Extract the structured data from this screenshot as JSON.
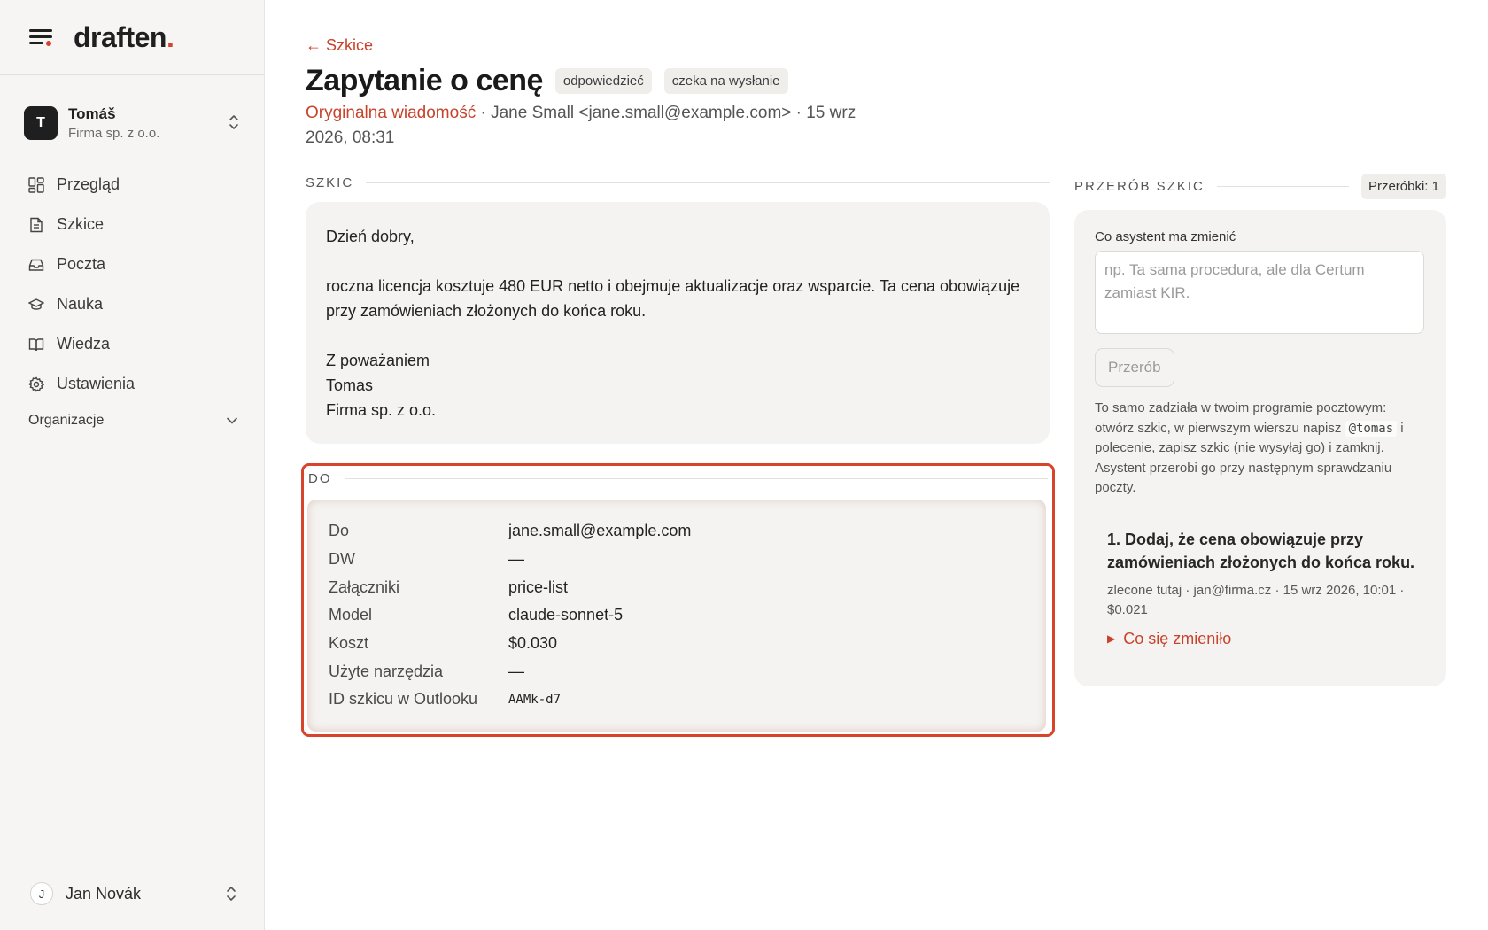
{
  "brand": {
    "name": "draften",
    "dot": "."
  },
  "org": {
    "initial": "T",
    "name": "Tomáš",
    "subtitle": "Firma sp. z o.o."
  },
  "nav": [
    {
      "label": "Przegląd",
      "icon": "grid-icon"
    },
    {
      "label": "Szkice",
      "icon": "file-icon"
    },
    {
      "label": "Poczta",
      "icon": "inbox-icon"
    },
    {
      "label": "Nauka",
      "icon": "graduation-cap-icon"
    },
    {
      "label": "Wiedza",
      "icon": "book-icon"
    },
    {
      "label": "Ustawienia",
      "icon": "gear-icon"
    }
  ],
  "organizations_label": "Organizacje",
  "user": {
    "initial": "J",
    "name": "Jan Novák"
  },
  "header": {
    "back": "← Szkice",
    "title": "Zapytanie o cenę",
    "badges": [
      "odpowiedzieć",
      "czeka na wysłanie"
    ],
    "original_link": "Oryginalna wiadomość",
    "meta_rest": " · Jane Small <jane.small@example.com> · 15 wrz 2026, 08:31"
  },
  "draft": {
    "label": "SZKIC",
    "greeting": "Dzień dobry,",
    "body": "roczna licencja kosztuje 480 EUR netto i obejmuje aktualizacje oraz wsparcie. Ta cena obowiązuje przy zamówieniach złożonych do końca roku.",
    "closing": "Z poważaniem",
    "signature_name": "Tomas",
    "signature_company": "Firma sp. z o.o."
  },
  "do_section": {
    "label": "DO",
    "rows": [
      {
        "key": "Do",
        "value": "jane.small@example.com"
      },
      {
        "key": "DW",
        "value": "—"
      },
      {
        "key": "Załączniki",
        "value": "price-list"
      },
      {
        "key": "Model",
        "value": "claude-sonnet-5"
      },
      {
        "key": "Koszt",
        "value": "$0.030"
      },
      {
        "key": "Użyte narzędzia",
        "value": "—"
      },
      {
        "key": "ID szkicu w Outlooku",
        "value": "AAMk-d7"
      }
    ]
  },
  "rework": {
    "label": "PRZERÓB SZKIC",
    "count": "Przeróbki: 1",
    "field_label": "Co asystent ma zmienić",
    "placeholder": "np. Ta sama procedura, ale dla Certum zamiast KIR.",
    "button": "Przerób",
    "help_before": "To samo zadziała w twoim programie pocztowym: otwórz szkic, w pierwszym wierszu napisz ",
    "help_code": "@tomas",
    "help_after": " i polecenie, zapisz szkic (nie wysyłaj go) i zamknij. Asystent przerobi go przy następnym sprawdzaniu poczty.",
    "entry_title": "1. Dodaj, że cena obowiązuje przy zamówieniach złożonych do końca roku.",
    "entry_meta": "zlecone tutaj · jan@firma.cz · 15 wrz 2026, 10:01 · $0.021",
    "entry_toggle": "Co się zmieniło"
  },
  "colors": {
    "accent": "#d2442c",
    "link": "#c8432b",
    "card": "#f4f3f1",
    "sidebar": "#f6f5f3"
  }
}
